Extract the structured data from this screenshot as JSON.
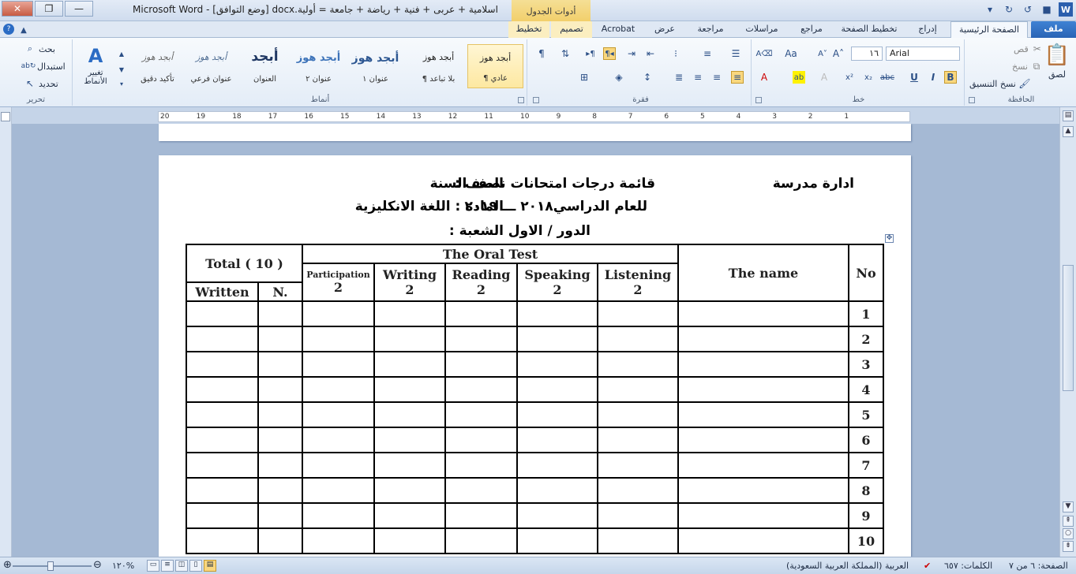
{
  "titlebar": {
    "doc_title": "اسلامية + عربى + فنية + رياضة + جامعة = أولية.docx [وضع التوافق] - Microsoft Word",
    "context_group": "أدوات الجدول"
  },
  "tabs": {
    "file": "ملف",
    "home": "الصفحة الرئيسية",
    "insert": "إدراج",
    "page_layout": "تخطيط الصفحة",
    "references": "مراجع",
    "mailings": "مراسلات",
    "review": "مراجعة",
    "view": "عرض",
    "acrobat": "Acrobat",
    "design": "تصميم",
    "layout": "تخطيط"
  },
  "ribbon": {
    "clipboard": {
      "label": "الحافظة",
      "paste": "لصق",
      "cut": "قص",
      "copy": "نسخ",
      "format_painter": "نسخ التنسيق"
    },
    "font": {
      "label": "خط",
      "font_name": "Arial",
      "font_size": "١٦"
    },
    "paragraph": {
      "label": "فقرة"
    },
    "styles": {
      "label": "أنماط",
      "items": [
        {
          "sample": "أبجد هوز",
          "name": "¶ عادي"
        },
        {
          "sample": "أبجد هوز",
          "name": "¶ بلا تباعد"
        },
        {
          "sample": "أبجد هوز",
          "name": "عنوان ١"
        },
        {
          "sample": "أبجد هوز",
          "name": "عنوان ٢"
        },
        {
          "sample": "أبجد",
          "name": "العنوان"
        },
        {
          "sample": "أبجد هوز",
          "name": "عنوان فرعي"
        },
        {
          "sample": "أبجد هوز",
          "name": "تأكيد دقيق"
        }
      ],
      "change_styles": "تغيير الأنماط"
    },
    "editing": {
      "label": "تحرير",
      "find": "بحث",
      "replace": "استبدال",
      "select": "تحديد"
    }
  },
  "ruler": {
    "numbers": [
      "20",
      "19",
      "18",
      "17",
      "16",
      "15",
      "14",
      "13",
      "12",
      "11",
      "10",
      "9",
      "8",
      "7",
      "6",
      "5",
      "4",
      "3",
      "2",
      "1"
    ]
  },
  "document": {
    "header": {
      "school": "ادارة مدرسة",
      "title": "قائمة درجات امتحانات نصف السنة",
      "class_label": "الصف :",
      "year": "للعام الدراسي٢٠١٨ ـــ ٢٠١٩",
      "subject": "المادة : اللغة الانكليزية",
      "round": "الدور / الاول",
      "section": "الشعبة :"
    },
    "table": {
      "total_header": "Total ( 10 )",
      "written": "Written",
      "n": "N.",
      "oral_test": "The Oral Test",
      "participation": "Participation",
      "writing": "Writing",
      "reading": "Reading",
      "speaking": "Speaking",
      "listening": "Listening",
      "max_score": "2",
      "name_header": "The name",
      "no_header": "No",
      "rows": [
        "1",
        "2",
        "3",
        "4",
        "5",
        "6",
        "7",
        "8",
        "9",
        "10"
      ]
    }
  },
  "statusbar": {
    "page": "الصفحة: ٦ من ٧",
    "words": "الكلمات: ٦٥٧",
    "language": "العربية (المملكة العربية السعودية)",
    "zoom": "١٢٠%"
  }
}
